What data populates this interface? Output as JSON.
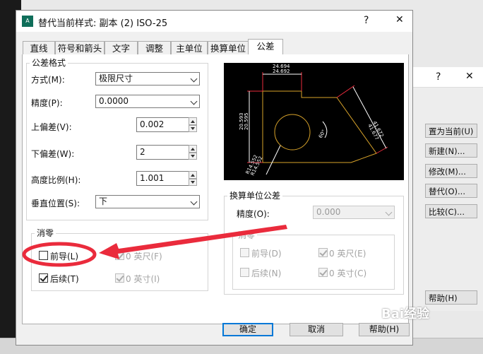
{
  "dialog": {
    "title": "替代当前样式: 副本 (2) ISO-25",
    "help_glyph": "?",
    "close_glyph": "✕",
    "tabs": [
      {
        "label": "直线"
      },
      {
        "label": "符号和箭头"
      },
      {
        "label": "文字"
      },
      {
        "label": "调整"
      },
      {
        "label": "主单位"
      },
      {
        "label": "换算单位"
      },
      {
        "label": "公差"
      }
    ],
    "active_tab": "公差"
  },
  "tolerance_format": {
    "group_label": "公差格式",
    "method_label": "方式(M):",
    "method_value": "极限尺寸",
    "precision_label": "精度(P):",
    "precision_value": "0.0000",
    "upper_label": "上偏差(V):",
    "upper_value": "0.002",
    "lower_label": "下偏差(W):",
    "lower_value": "2",
    "height_label": "高度比例(H):",
    "height_value": "1.001",
    "vpos_label": "垂直位置(S):",
    "vpos_value": "下"
  },
  "zero_suppression": {
    "group_label": "消零",
    "leading_label": "前导(L)",
    "leading_checked": false,
    "trailing_label": "后续(T)",
    "trailing_checked": true,
    "feet_label": "0 英尺(F)",
    "inches_label": "0 英寸(I)"
  },
  "alt_tolerance": {
    "group_label": "换算单位公差",
    "precision_label": "精度(O):",
    "precision_value": "0.000",
    "zero_label": "消零",
    "leading_label": "前导(D)",
    "trailing_label": "后续(N)",
    "feet_label": "0 英尺(E)",
    "inches_label": "0 英寸(C)"
  },
  "preview": {
    "dims": [
      "24.694",
      "24.692",
      "20.593",
      "20.595",
      "41.677",
      "41.672",
      "60°",
      "R14.552",
      "R14.552"
    ]
  },
  "buttons": {
    "ok": "确定",
    "cancel": "取消",
    "help": "帮助(H)"
  },
  "background_window": {
    "help_glyph": "?",
    "close_glyph": "✕",
    "buttons": [
      "置为当前(U)",
      "新建(N)...",
      "修改(M)...",
      "替代(O)...",
      "比较(C)..."
    ],
    "help_button": "帮助(H)"
  },
  "watermark": "Bai经验",
  "colors": {
    "annotation_red": "#ea2b3c",
    "accent_blue": "#0078d7",
    "preview_geometry": "#d8a32a"
  }
}
